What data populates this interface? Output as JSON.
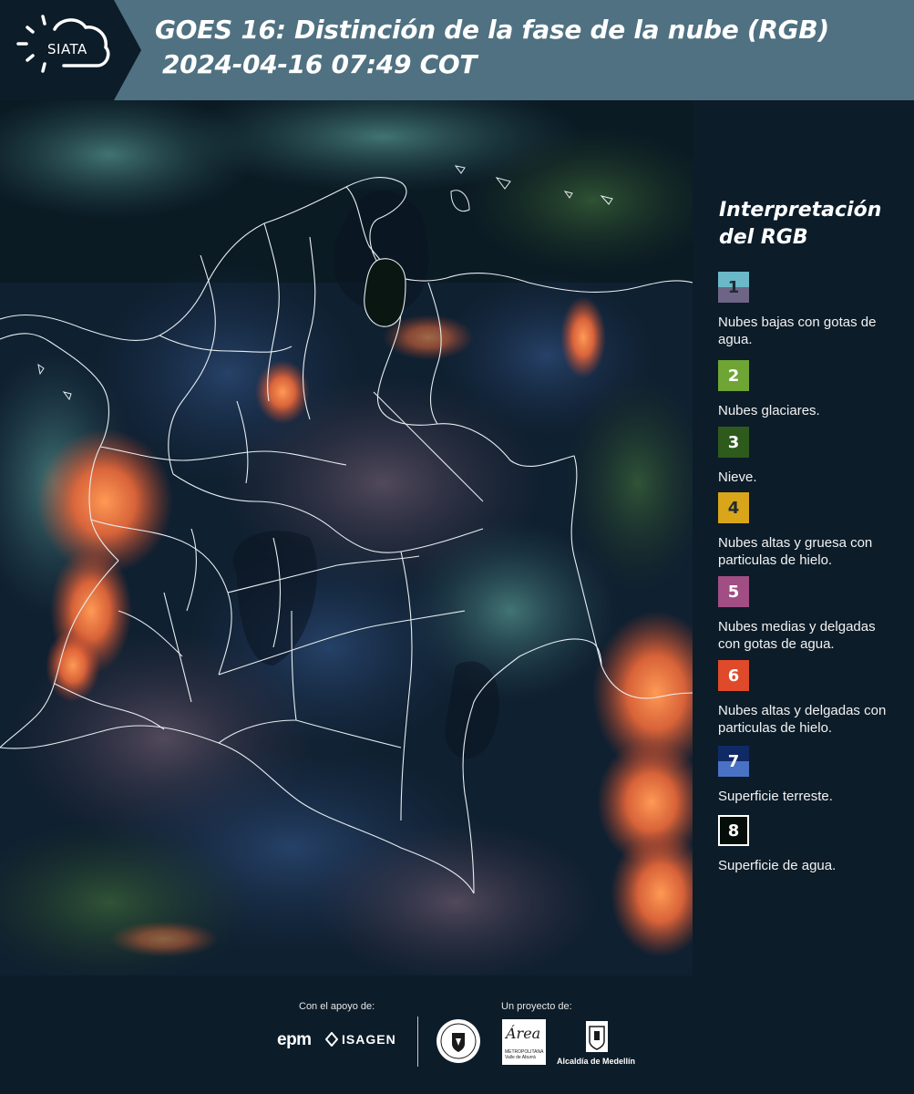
{
  "header": {
    "logo_text": "SIATA",
    "title_line1": "GOES 16: Distinción de la fase de la nube (RGB)",
    "title_line2": "2024-04-16 07:49 COT",
    "background_color": "#4f7181"
  },
  "legend": {
    "title": "Interpretación del RGB",
    "items": [
      {
        "number": "1",
        "label": "Nubes bajas con gotas de agua.",
        "colors": [
          "#6ab8c8",
          "#6e6586"
        ]
      },
      {
        "number": "2",
        "label": "Nubes glaciares.",
        "colors": [
          "#6ea534"
        ]
      },
      {
        "number": "3",
        "label": "Nieve.",
        "colors": [
          "#2e5a1c"
        ]
      },
      {
        "number": "4",
        "label": "Nubes altas y gruesa con particulas de hielo.",
        "colors": [
          "#d8a51b"
        ]
      },
      {
        "number": "5",
        "label": "Nubes medias y delgadas con gotas de agua.",
        "colors": [
          "#a14e85"
        ]
      },
      {
        "number": "6",
        "label": "Nubes altas y delgadas con particulas de hielo.",
        "colors": [
          "#df4a2a"
        ]
      },
      {
        "number": "7",
        "label": "Superficie terreste.",
        "colors": [
          "#102a66",
          "#4a72c4"
        ]
      },
      {
        "number": "8",
        "label": "Superficie de agua.",
        "colors": [
          "#050d08"
        ]
      }
    ]
  },
  "footer": {
    "support_label": "Con el apoyo de:",
    "project_label": "Un proyecto de:",
    "sponsor_1": "epm",
    "sponsor_2": "ISAGEN",
    "partner_area": "Área",
    "partner_area_sub": "METROPOLITANA Valle de Aburrá",
    "partner_alcaldia": "Alcaldía de Medellín"
  }
}
